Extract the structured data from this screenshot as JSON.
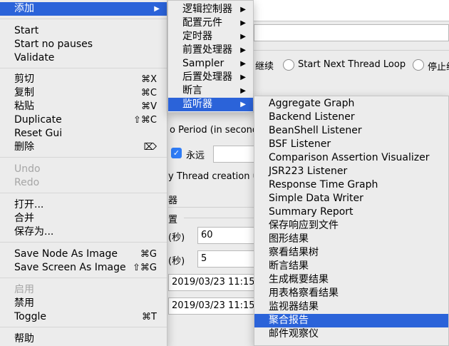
{
  "background": {
    "continue_radio": "继续",
    "start_next_radio": "Start Next Thread Loop",
    "stop_radio": "停止线",
    "ramp_up_label": "o Period (in seconds)",
    "forever_checkbox": "永远",
    "delay_thread": "y Thread creation ur",
    "scheduler_label": "器",
    "config_label": "置",
    "duration_label": "(秒)",
    "duration_value": "60",
    "delay_label": "(秒)",
    "delay_value": "5",
    "start_time": "2019/03/23 11:15",
    "end_time": "2019/03/23 11:15"
  },
  "main_menu": {
    "add": "添加",
    "start": "Start",
    "start_no_pauses": "Start no pauses",
    "validate": "Validate",
    "cut": "剪切",
    "cut_sc": "⌘X",
    "copy": "复制",
    "copy_sc": "⌘C",
    "paste": "粘贴",
    "paste_sc": "⌘V",
    "duplicate": "Duplicate",
    "duplicate_sc": "⇧⌘C",
    "reset_gui": "Reset Gui",
    "delete": "删除",
    "delete_sc": "⌦",
    "undo": "Undo",
    "redo": "Redo",
    "open": "打开...",
    "merge": "合并",
    "save_as": "保存为...",
    "save_node_image": "Save Node As Image",
    "save_node_image_sc": "⌘G",
    "save_screen_image": "Save Screen As Image",
    "save_screen_image_sc": "⇧⌘G",
    "enable": "启用",
    "disable": "禁用",
    "toggle": "Toggle",
    "toggle_sc": "⌘T",
    "help": "帮助"
  },
  "add_submenu": {
    "logic_controller": "逻辑控制器",
    "config_element": "配置元件",
    "timer": "定时器",
    "pre_processor": "前置处理器",
    "sampler": "Sampler",
    "post_processor": "后置处理器",
    "assertion": "断言",
    "listener": "监听器"
  },
  "listener_submenu": [
    "Aggregate Graph",
    "Backend Listener",
    "BeanShell Listener",
    "BSF Listener",
    "Comparison Assertion Visualizer",
    "JSR223 Listener",
    "Response Time Graph",
    "Simple Data Writer",
    "Summary Report",
    "保存响应到文件",
    "图形结果",
    "察看结果树",
    "断言结果",
    "生成概要结果",
    "用表格察看结果",
    "监视器结果",
    "聚合报告",
    "邮件观察仪"
  ],
  "colors": {
    "selection": "#2b63d9",
    "menu_bg": "#ececec",
    "disabled_text": "#a6a6a6"
  }
}
